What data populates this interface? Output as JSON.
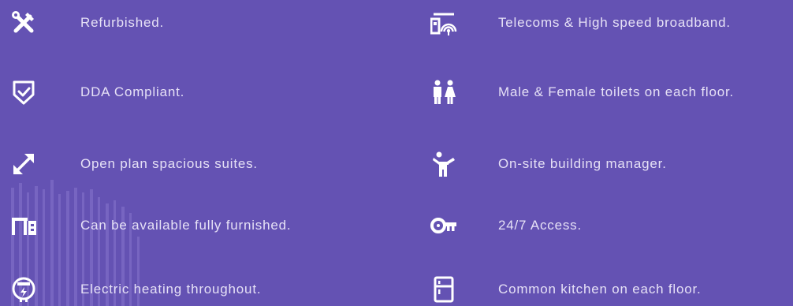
{
  "colors": {
    "background": "#6452B3",
    "icon": "#FFFFFF",
    "text": "#E6E1F6"
  },
  "features": {
    "left": [
      {
        "label": "Refurbished.",
        "icon": "tools-icon"
      },
      {
        "label": "DDA Compliant.",
        "icon": "shield-check-icon"
      },
      {
        "label": "Open plan spacious suites.",
        "icon": "expand-arrows-icon"
      },
      {
        "label": "Can be available fully furnished.",
        "icon": "furniture-icon"
      },
      {
        "label": "Electric heating throughout.",
        "icon": "electric-meter-icon"
      }
    ],
    "right": [
      {
        "label": "Telecoms & High speed broadband.",
        "icon": "router-wifi-icon"
      },
      {
        "label": "Male & Female toilets on each floor.",
        "icon": "toilets-icon"
      },
      {
        "label": "On-site building manager.",
        "icon": "manager-icon"
      },
      {
        "label": "24/7 Access.",
        "icon": "key-icon"
      },
      {
        "label": "Common kitchen on each floor.",
        "icon": "fridge-icon"
      }
    ]
  }
}
